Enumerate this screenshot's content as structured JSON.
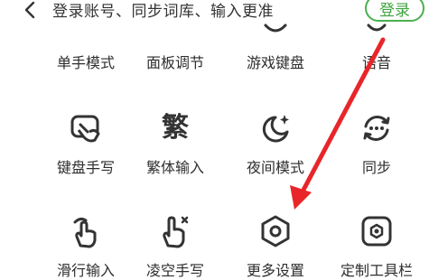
{
  "header": {
    "promo_text": "登录账号、同步词库、输入更准",
    "login_label": "登录"
  },
  "grid": {
    "row1": [
      "单手模式",
      "面板调节",
      "游戏键盘",
      "语音"
    ],
    "row2": [
      "键盘手写",
      "繁体输入",
      "夜间模式",
      "同步"
    ],
    "row3": [
      "滑行输入",
      "凌空手写",
      "更多设置",
      "定制工具栏"
    ],
    "fanti_glyph": "繁"
  },
  "colors": {
    "accent_green": "#3ea43e",
    "arrow_red": "#e8262a",
    "icon_dark": "#333333"
  }
}
